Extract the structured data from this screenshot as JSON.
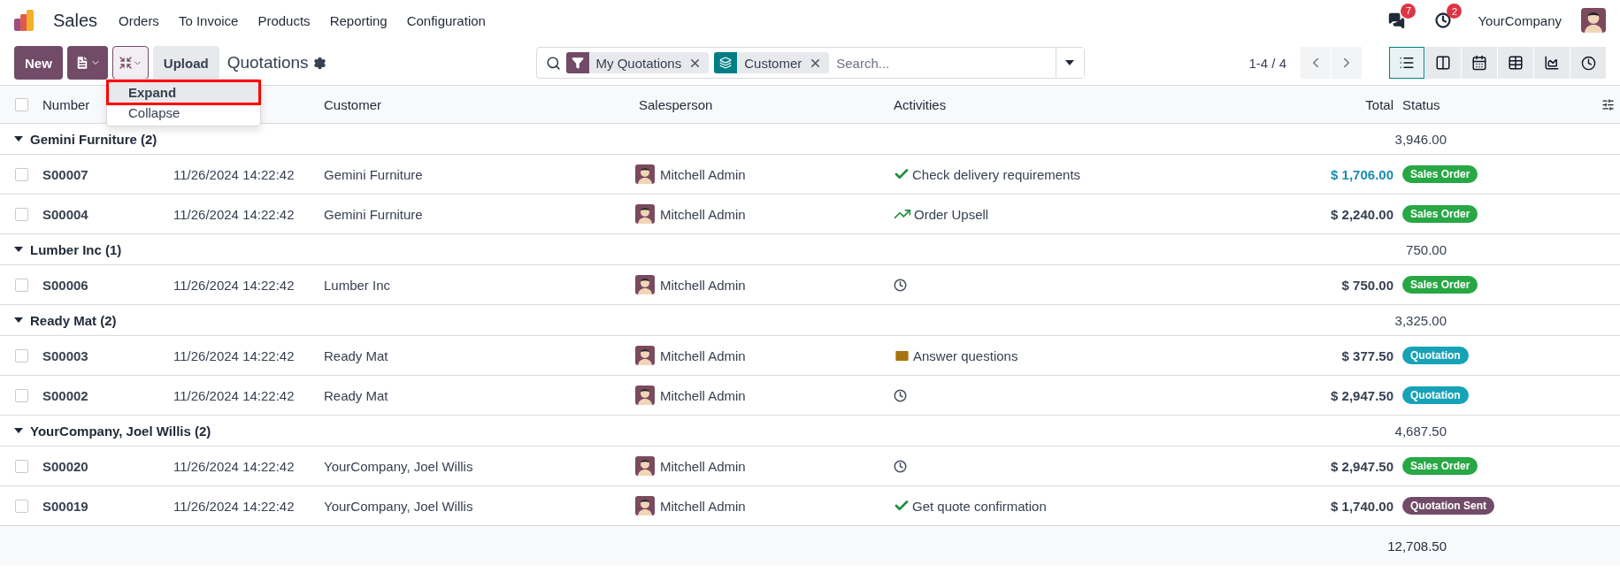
{
  "app": {
    "name": "Sales",
    "menu": [
      "Orders",
      "To Invoice",
      "Products",
      "Reporting",
      "Configuration"
    ]
  },
  "systray": {
    "messages_count": "7",
    "activities_count": "2",
    "company": "YourCompany"
  },
  "control_panel": {
    "new_button": "New",
    "upload_button": "Upload",
    "title": "Quotations",
    "dropdown": [
      {
        "label": "Expand",
        "selected": true
      },
      {
        "label": "Collapse",
        "selected": false
      }
    ],
    "facets": [
      {
        "kind": "filter",
        "label": "My Quotations"
      },
      {
        "kind": "group",
        "label": "Customer"
      }
    ],
    "search": {
      "placeholder": "Search..."
    },
    "pager": "1-4 / 4",
    "views": [
      {
        "kind": "list",
        "selected": true
      },
      {
        "kind": "kanban",
        "selected": false
      },
      {
        "kind": "calendar",
        "selected": false
      },
      {
        "kind": "pivot",
        "selected": false
      },
      {
        "kind": "graph",
        "selected": false
      },
      {
        "kind": "activity",
        "selected": false
      }
    ]
  },
  "table": {
    "all_checked": false,
    "columns": {
      "number": "Number",
      "customer": "Customer",
      "salesperson": "Salesperson",
      "activities": "Activities",
      "total": "Total",
      "status": "Status"
    },
    "groups": [
      {
        "label": "Gemini Furniture (2)",
        "total": "3,946.00",
        "expanded": true,
        "rows": [
          {
            "checked": false,
            "number": "S00007",
            "date": "11/26/2024 14:22:42",
            "customer": "Gemini Furniture",
            "salesperson": "Mitchell Admin",
            "activity": {
              "kind": "check",
              "text": "Check delivery requirements"
            },
            "total": "$ 1,706.00",
            "total_highlighted": true,
            "status": {
              "label": "Sales Order",
              "color": "#28a745"
            }
          },
          {
            "checked": false,
            "number": "S00004",
            "date": "11/26/2024 14:22:42",
            "customer": "Gemini Furniture",
            "salesperson": "Mitchell Admin",
            "activity": {
              "kind": "trend",
              "text": "Order Upsell"
            },
            "total": "$ 2,240.00",
            "total_highlighted": false,
            "status": {
              "label": "Sales Order",
              "color": "#28a745"
            }
          }
        ]
      },
      {
        "label": "Lumber Inc (1)",
        "total": "750.00",
        "expanded": true,
        "rows": [
          {
            "checked": false,
            "number": "S00006",
            "date": "11/26/2024 14:22:42",
            "customer": "Lumber Inc",
            "salesperson": "Mitchell Admin",
            "activity": {
              "kind": "clock"
            },
            "total": "$ 750.00",
            "total_highlighted": false,
            "status": {
              "label": "Sales Order",
              "color": "#28a745"
            }
          }
        ]
      },
      {
        "label": "Ready Mat (2)",
        "total": "3,325.00",
        "expanded": true,
        "rows": [
          {
            "checked": false,
            "number": "S00003",
            "date": "11/26/2024 14:22:42",
            "customer": "Ready Mat",
            "salesperson": "Mitchell Admin",
            "activity": {
              "kind": "email",
              "text": "Answer questions"
            },
            "total": "$ 377.50",
            "total_highlighted": false,
            "status": {
              "label": "Quotation",
              "color": "#17a2b8"
            }
          },
          {
            "checked": false,
            "number": "S00002",
            "date": "11/26/2024 14:22:42",
            "customer": "Ready Mat",
            "salesperson": "Mitchell Admin",
            "activity": {
              "kind": "clock"
            },
            "total": "$ 2,947.50",
            "total_highlighted": false,
            "status": {
              "label": "Quotation",
              "color": "#17a2b8"
            }
          }
        ]
      },
      {
        "label": "YourCompany, Joel Willis (2)",
        "total": "4,687.50",
        "expanded": true,
        "rows": [
          {
            "checked": false,
            "number": "S00020",
            "date": "11/26/2024 14:22:42",
            "customer": "YourCompany, Joel Willis",
            "salesperson": "Mitchell Admin",
            "activity": {
              "kind": "clock"
            },
            "total": "$ 2,947.50",
            "total_highlighted": false,
            "status": {
              "label": "Sales Order",
              "color": "#28a745"
            }
          },
          {
            "checked": false,
            "number": "S00019",
            "date": "11/26/2024 14:22:42",
            "customer": "YourCompany, Joel Willis",
            "salesperson": "Mitchell Admin",
            "activity": {
              "kind": "check",
              "text": "Get quote confirmation"
            },
            "total": "$ 1,740.00",
            "total_highlighted": false,
            "status": {
              "label": "Quotation Sent",
              "color": "#714b67"
            }
          }
        ]
      }
    ],
    "grand_total": "12,708.50"
  }
}
